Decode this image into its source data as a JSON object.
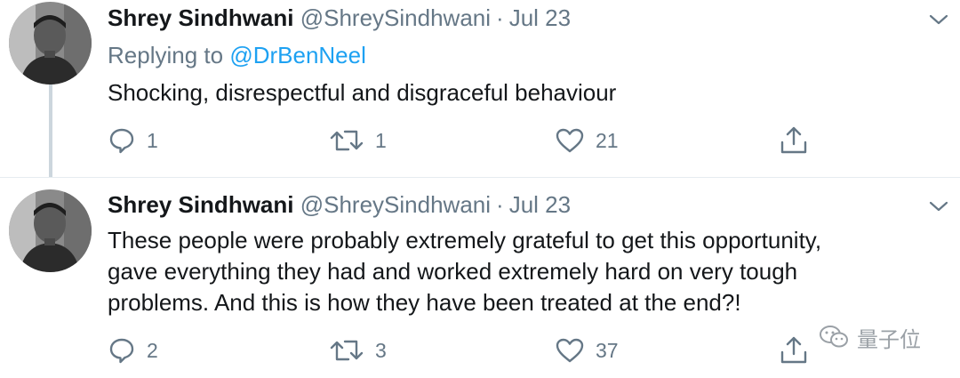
{
  "tweets": [
    {
      "author_name": "Shrey Sindhwani",
      "handle": "@ShreySindhwani",
      "separator": "·",
      "date": "Jul 23",
      "replying_prefix": "Replying to",
      "replying_to": "@DrBenNeel",
      "text_lines": [
        "Shocking, disrespectful and disgraceful behaviour"
      ],
      "reply_count": "1",
      "retweet_count": "1",
      "like_count": "21"
    },
    {
      "author_name": "Shrey Sindhwani",
      "handle": "@ShreySindhwani",
      "separator": "·",
      "date": "Jul 23",
      "text_lines": [
        "These people were probably extremely grateful to get this opportunity,",
        "gave everything they had and worked extremely hard on very tough",
        "problems. And this is how they have been treated at the end?!"
      ],
      "reply_count": "2",
      "retweet_count": "3",
      "like_count": "37"
    }
  ],
  "watermark": {
    "text": "量子位"
  },
  "colors": {
    "text": "#14171a",
    "secondary": "#657786",
    "link": "#1da1f2",
    "thread_line": "#ccd6dd",
    "divider": "#e6ecf0"
  },
  "icons": [
    "avatar",
    "chevron-down-icon",
    "reply-icon",
    "retweet-icon",
    "like-icon",
    "share-icon",
    "wechat-icon"
  ]
}
